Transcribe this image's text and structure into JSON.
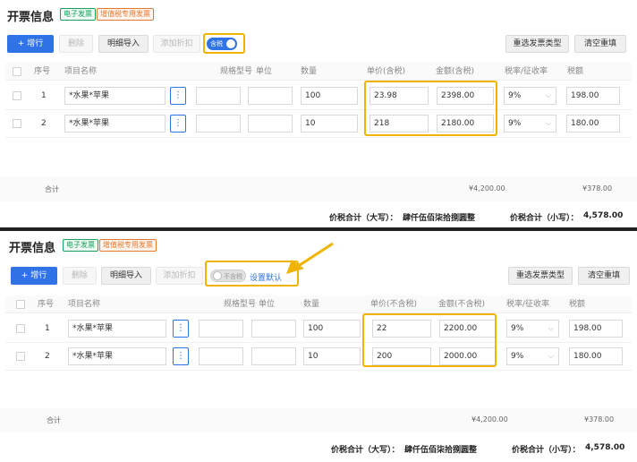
{
  "panels": [
    {
      "title": "开票信息",
      "tags": [
        "电子发票",
        "增值税专用发票"
      ],
      "toolbar": {
        "add_row": "+ 增行",
        "delete": "删除",
        "detail_import": "明细导入",
        "add_discount": "添加折扣",
        "tax_toggle_label": "含税",
        "tax_toggle_on": true,
        "reselect": "重选发票类型",
        "clear": "清空重填"
      },
      "columns": [
        "序号",
        "项目名称",
        "规格型号",
        "单位",
        "数量",
        "单价(含税)",
        "金额(含税)",
        "税率/征收率",
        "税额"
      ],
      "rows": [
        {
          "no": "1",
          "name": "*水果*苹果",
          "spec": "",
          "unit": "",
          "qty": "100",
          "price": "23.98",
          "amount": "2398.00",
          "rate": "9%",
          "tax": "198.00"
        },
        {
          "no": "2",
          "name": "*水果*苹果",
          "spec": "",
          "unit": "",
          "qty": "10",
          "price": "218",
          "amount": "2180.00",
          "rate": "9%",
          "tax": "180.00"
        }
      ],
      "summary": {
        "label": "合计",
        "amount": "¥4,200.00",
        "tax": "¥378.00"
      },
      "total": {
        "upper_label": "价税合计（大写）：",
        "upper_value": "肆仟伍佰柒拾捌圆整",
        "lower_label": "价税合计（小写）：",
        "lower_value": "4,578.00"
      }
    },
    {
      "title": "开票信息",
      "tags": [
        "电子发票",
        "增值税专用发票"
      ],
      "toolbar": {
        "add_row": "+ 增行",
        "delete": "删除",
        "detail_import": "明细导入",
        "add_discount": "添加折扣",
        "tax_toggle_label": "不含税",
        "tax_toggle_on": false,
        "set_default": "设置默认",
        "reselect": "重选发票类型",
        "clear": "清空重填"
      },
      "columns": [
        "序号",
        "项目名称",
        "规格型号",
        "单位",
        "数量",
        "单价(不含税)",
        "金额(不含税)",
        "税率/征收率",
        "税额"
      ],
      "rows": [
        {
          "no": "1",
          "name": "*水果*苹果",
          "spec": "",
          "unit": "",
          "qty": "100",
          "price": "22",
          "amount": "2200.00",
          "rate": "9%",
          "tax": "198.00"
        },
        {
          "no": "2",
          "name": "*水果*苹果",
          "spec": "",
          "unit": "",
          "qty": "10",
          "price": "200",
          "amount": "2000.00",
          "rate": "9%",
          "tax": "180.00"
        }
      ],
      "summary": {
        "label": "合计",
        "amount": "¥4,200.00",
        "tax": "¥378.00"
      },
      "total": {
        "upper_label": "价税合计（大写）：",
        "upper_value": "肆仟伍佰柒拾捌圆整",
        "lower_label": "价税合计（小写）：",
        "lower_value": "4,578.00"
      }
    }
  ],
  "colors": {
    "primary": "#2f73e6",
    "highlight": "#f0b400",
    "tag_green": "#19a15f",
    "tag_orange": "#e8772e"
  },
  "icons": {
    "more": "vertical-ellipsis-icon",
    "dropdown": "chevron-down-icon",
    "arrow": "callout-arrow-icon"
  }
}
